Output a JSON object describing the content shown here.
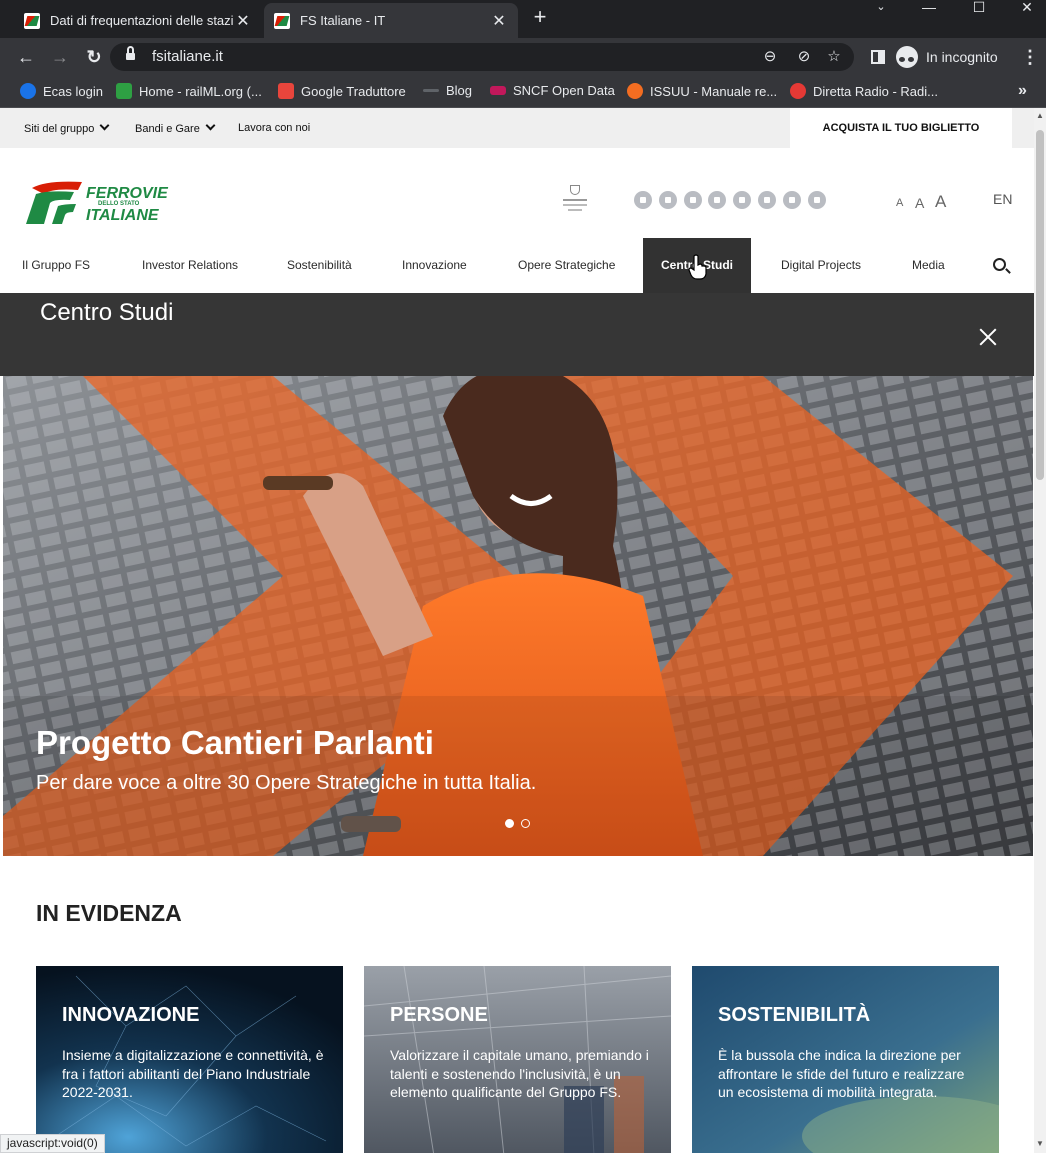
{
  "browser": {
    "tabs": [
      {
        "title": "Dati di frequentazioni delle stazio",
        "active": false
      },
      {
        "title": "FS Italiane - IT",
        "active": true
      }
    ],
    "new_tab": "+",
    "url": "fsitaliane.it",
    "incognito_label": "In incognito",
    "bookmarks": [
      {
        "label": "Ecas login",
        "color": "#1a73e8"
      },
      {
        "label": "Home - railML.org (...",
        "color": "#2ea043"
      },
      {
        "label": "Google Traduttore",
        "color": "#e8453c"
      },
      {
        "label": "Blog",
        "color": "#5f6368"
      },
      {
        "label": "SNCF Open Data",
        "color": "#c2185b"
      },
      {
        "label": "ISSUU - Manuale re...",
        "color": "#f36d21"
      },
      {
        "label": "Diretta Radio - Radi...",
        "color": "#e53935"
      }
    ],
    "bookmarks_more": "»",
    "status_text": "javascript:void(0)"
  },
  "topbar": {
    "group_sites": "Siti del gruppo",
    "tenders": "Bandi e Gare",
    "careers": "Lavora con noi",
    "buy_ticket": "ACQUISTA IL TUO BIGLIETTO"
  },
  "header": {
    "logo": {
      "line1": "FERROVIE",
      "line2": "DELLO STATO",
      "line3": "ITALIANE"
    },
    "social_icons": [
      "podcast-icon",
      "tiktok-icon",
      "spotify-icon",
      "twitter-icon",
      "instagram-icon",
      "youtube-icon",
      "linkedin-icon",
      "telegram-icon"
    ],
    "font_size_controls": [
      "A",
      "A",
      "A"
    ],
    "language": "EN"
  },
  "nav": {
    "items": [
      "Il Gruppo FS",
      "Investor Relations",
      "Sostenibilità",
      "Innovazione",
      "Opere Strategiche",
      "Centro Studi",
      "Digital Projects",
      "Media"
    ],
    "active": "Centro Studi"
  },
  "dropdown": {
    "title": "Centro Studi"
  },
  "hero": {
    "title": "Progetto Cantieri Parlanti",
    "subtitle": "Per dare voce a oltre 30 Opere Strategiche in tutta Italia.",
    "slides": 2,
    "active_slide": 1
  },
  "evidenza": {
    "heading": "IN EVIDENZA",
    "cards": [
      {
        "title": "INNOVAZIONE",
        "text": "Insieme a digitalizzazione e connettività, è fra i fattori abilitanti del Piano Industriale 2022-2031."
      },
      {
        "title": "PERSONE",
        "text": "Valorizzare il capitale umano, premiando i talenti e sostenendo l'inclusività, è un elemento qualificante del Gruppo FS."
      },
      {
        "title": "SOSTENIBILITÀ",
        "text": "È la bussola che indica la direzione per affrontare le sfide del futuro e realizzare un ecosistema di mobilità integrata."
      }
    ]
  },
  "colors": {
    "brand_red": "#d81e05",
    "brand_green": "#1f8a44",
    "hero_orange": "#f0631e",
    "nav_dark": "#323232"
  }
}
